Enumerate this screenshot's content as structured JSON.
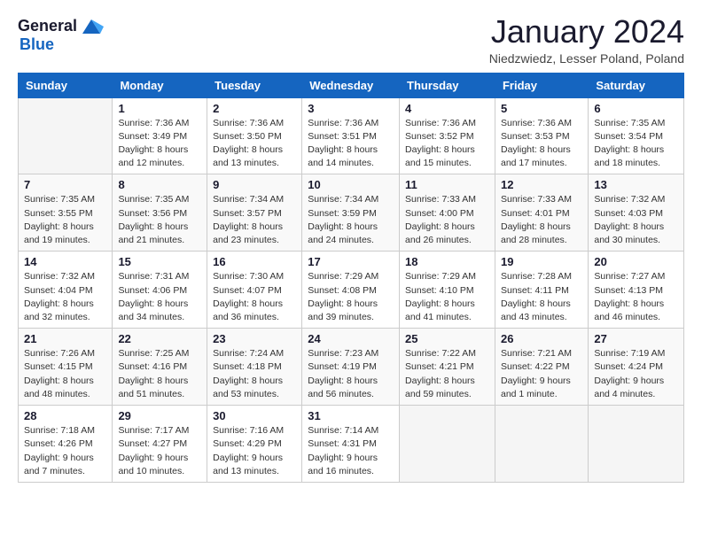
{
  "header": {
    "logo_line1": "General",
    "logo_line2": "Blue",
    "title": "January 2024",
    "subtitle": "Niedzwiedz, Lesser Poland, Poland"
  },
  "days_of_week": [
    "Sunday",
    "Monday",
    "Tuesday",
    "Wednesday",
    "Thursday",
    "Friday",
    "Saturday"
  ],
  "weeks": [
    [
      {
        "day": "",
        "sunrise": "",
        "sunset": "",
        "daylight": ""
      },
      {
        "day": "1",
        "sunrise": "Sunrise: 7:36 AM",
        "sunset": "Sunset: 3:49 PM",
        "daylight": "Daylight: 8 hours and 12 minutes."
      },
      {
        "day": "2",
        "sunrise": "Sunrise: 7:36 AM",
        "sunset": "Sunset: 3:50 PM",
        "daylight": "Daylight: 8 hours and 13 minutes."
      },
      {
        "day": "3",
        "sunrise": "Sunrise: 7:36 AM",
        "sunset": "Sunset: 3:51 PM",
        "daylight": "Daylight: 8 hours and 14 minutes."
      },
      {
        "day": "4",
        "sunrise": "Sunrise: 7:36 AM",
        "sunset": "Sunset: 3:52 PM",
        "daylight": "Daylight: 8 hours and 15 minutes."
      },
      {
        "day": "5",
        "sunrise": "Sunrise: 7:36 AM",
        "sunset": "Sunset: 3:53 PM",
        "daylight": "Daylight: 8 hours and 17 minutes."
      },
      {
        "day": "6",
        "sunrise": "Sunrise: 7:35 AM",
        "sunset": "Sunset: 3:54 PM",
        "daylight": "Daylight: 8 hours and 18 minutes."
      }
    ],
    [
      {
        "day": "7",
        "sunrise": "Sunrise: 7:35 AM",
        "sunset": "Sunset: 3:55 PM",
        "daylight": "Daylight: 8 hours and 19 minutes."
      },
      {
        "day": "8",
        "sunrise": "Sunrise: 7:35 AM",
        "sunset": "Sunset: 3:56 PM",
        "daylight": "Daylight: 8 hours and 21 minutes."
      },
      {
        "day": "9",
        "sunrise": "Sunrise: 7:34 AM",
        "sunset": "Sunset: 3:57 PM",
        "daylight": "Daylight: 8 hours and 23 minutes."
      },
      {
        "day": "10",
        "sunrise": "Sunrise: 7:34 AM",
        "sunset": "Sunset: 3:59 PM",
        "daylight": "Daylight: 8 hours and 24 minutes."
      },
      {
        "day": "11",
        "sunrise": "Sunrise: 7:33 AM",
        "sunset": "Sunset: 4:00 PM",
        "daylight": "Daylight: 8 hours and 26 minutes."
      },
      {
        "day": "12",
        "sunrise": "Sunrise: 7:33 AM",
        "sunset": "Sunset: 4:01 PM",
        "daylight": "Daylight: 8 hours and 28 minutes."
      },
      {
        "day": "13",
        "sunrise": "Sunrise: 7:32 AM",
        "sunset": "Sunset: 4:03 PM",
        "daylight": "Daylight: 8 hours and 30 minutes."
      }
    ],
    [
      {
        "day": "14",
        "sunrise": "Sunrise: 7:32 AM",
        "sunset": "Sunset: 4:04 PM",
        "daylight": "Daylight: 8 hours and 32 minutes."
      },
      {
        "day": "15",
        "sunrise": "Sunrise: 7:31 AM",
        "sunset": "Sunset: 4:06 PM",
        "daylight": "Daylight: 8 hours and 34 minutes."
      },
      {
        "day": "16",
        "sunrise": "Sunrise: 7:30 AM",
        "sunset": "Sunset: 4:07 PM",
        "daylight": "Daylight: 8 hours and 36 minutes."
      },
      {
        "day": "17",
        "sunrise": "Sunrise: 7:29 AM",
        "sunset": "Sunset: 4:08 PM",
        "daylight": "Daylight: 8 hours and 39 minutes."
      },
      {
        "day": "18",
        "sunrise": "Sunrise: 7:29 AM",
        "sunset": "Sunset: 4:10 PM",
        "daylight": "Daylight: 8 hours and 41 minutes."
      },
      {
        "day": "19",
        "sunrise": "Sunrise: 7:28 AM",
        "sunset": "Sunset: 4:11 PM",
        "daylight": "Daylight: 8 hours and 43 minutes."
      },
      {
        "day": "20",
        "sunrise": "Sunrise: 7:27 AM",
        "sunset": "Sunset: 4:13 PM",
        "daylight": "Daylight: 8 hours and 46 minutes."
      }
    ],
    [
      {
        "day": "21",
        "sunrise": "Sunrise: 7:26 AM",
        "sunset": "Sunset: 4:15 PM",
        "daylight": "Daylight: 8 hours and 48 minutes."
      },
      {
        "day": "22",
        "sunrise": "Sunrise: 7:25 AM",
        "sunset": "Sunset: 4:16 PM",
        "daylight": "Daylight: 8 hours and 51 minutes."
      },
      {
        "day": "23",
        "sunrise": "Sunrise: 7:24 AM",
        "sunset": "Sunset: 4:18 PM",
        "daylight": "Daylight: 8 hours and 53 minutes."
      },
      {
        "day": "24",
        "sunrise": "Sunrise: 7:23 AM",
        "sunset": "Sunset: 4:19 PM",
        "daylight": "Daylight: 8 hours and 56 minutes."
      },
      {
        "day": "25",
        "sunrise": "Sunrise: 7:22 AM",
        "sunset": "Sunset: 4:21 PM",
        "daylight": "Daylight: 8 hours and 59 minutes."
      },
      {
        "day": "26",
        "sunrise": "Sunrise: 7:21 AM",
        "sunset": "Sunset: 4:22 PM",
        "daylight": "Daylight: 9 hours and 1 minute."
      },
      {
        "day": "27",
        "sunrise": "Sunrise: 7:19 AM",
        "sunset": "Sunset: 4:24 PM",
        "daylight": "Daylight: 9 hours and 4 minutes."
      }
    ],
    [
      {
        "day": "28",
        "sunrise": "Sunrise: 7:18 AM",
        "sunset": "Sunset: 4:26 PM",
        "daylight": "Daylight: 9 hours and 7 minutes."
      },
      {
        "day": "29",
        "sunrise": "Sunrise: 7:17 AM",
        "sunset": "Sunset: 4:27 PM",
        "daylight": "Daylight: 9 hours and 10 minutes."
      },
      {
        "day": "30",
        "sunrise": "Sunrise: 7:16 AM",
        "sunset": "Sunset: 4:29 PM",
        "daylight": "Daylight: 9 hours and 13 minutes."
      },
      {
        "day": "31",
        "sunrise": "Sunrise: 7:14 AM",
        "sunset": "Sunset: 4:31 PM",
        "daylight": "Daylight: 9 hours and 16 minutes."
      },
      {
        "day": "",
        "sunrise": "",
        "sunset": "",
        "daylight": ""
      },
      {
        "day": "",
        "sunrise": "",
        "sunset": "",
        "daylight": ""
      },
      {
        "day": "",
        "sunrise": "",
        "sunset": "",
        "daylight": ""
      }
    ]
  ]
}
